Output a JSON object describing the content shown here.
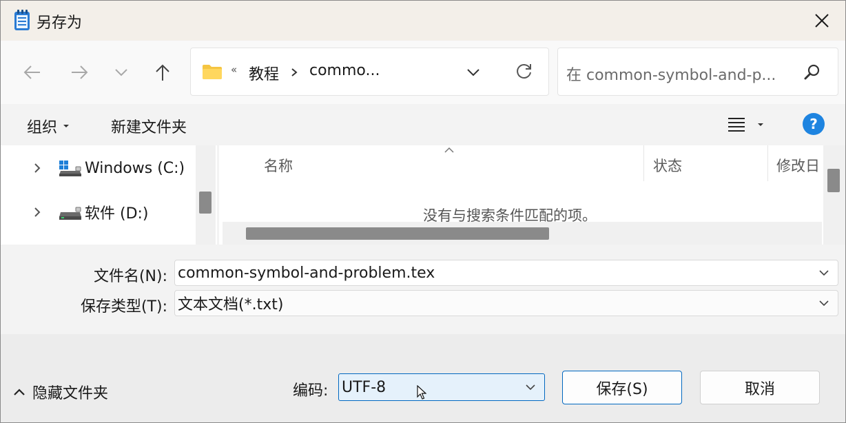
{
  "window": {
    "title": "另存为"
  },
  "nav": {
    "path_overflow": "«",
    "breadcrumbs": [
      "教程",
      "commo..."
    ],
    "search_placeholder": "在 common-symbol-and-p..."
  },
  "toolbar": {
    "organize": "组织",
    "new_folder": "新建文件夹",
    "help": "?"
  },
  "tree": {
    "items": [
      {
        "label": "Windows (C:)"
      },
      {
        "label": "软件 (D:)"
      }
    ]
  },
  "content": {
    "columns": [
      "名称",
      "状态",
      "修改日"
    ],
    "empty_message": "没有与搜索条件匹配的项。"
  },
  "form": {
    "filename_label": "文件名(N):",
    "filename_value": "common-symbol-and-problem.tex",
    "filetype_label": "保存类型(T):",
    "filetype_value": "文本文档(*.txt)"
  },
  "footer": {
    "hide_folders": "隐藏文件夹",
    "encoding_label": "编码:",
    "encoding_value": "UTF-8",
    "save": "保存(S)",
    "cancel": "取消"
  },
  "icons": {
    "app": "notepad-icon",
    "close": "close-icon",
    "back": "back-arrow-icon",
    "forward": "forward-arrow-icon",
    "recent": "chevron-down-icon",
    "up": "up-arrow-icon",
    "folder": "folder-icon",
    "refresh": "refresh-icon",
    "search": "search-icon",
    "view": "view-list-icon",
    "help": "help-icon",
    "drive": "drive-icon"
  },
  "colors": {
    "accent": "#0067c0",
    "help_bg": "#1e84e0",
    "title_bg": "#f3efe9",
    "scrollbar": "#8a8a8a"
  }
}
